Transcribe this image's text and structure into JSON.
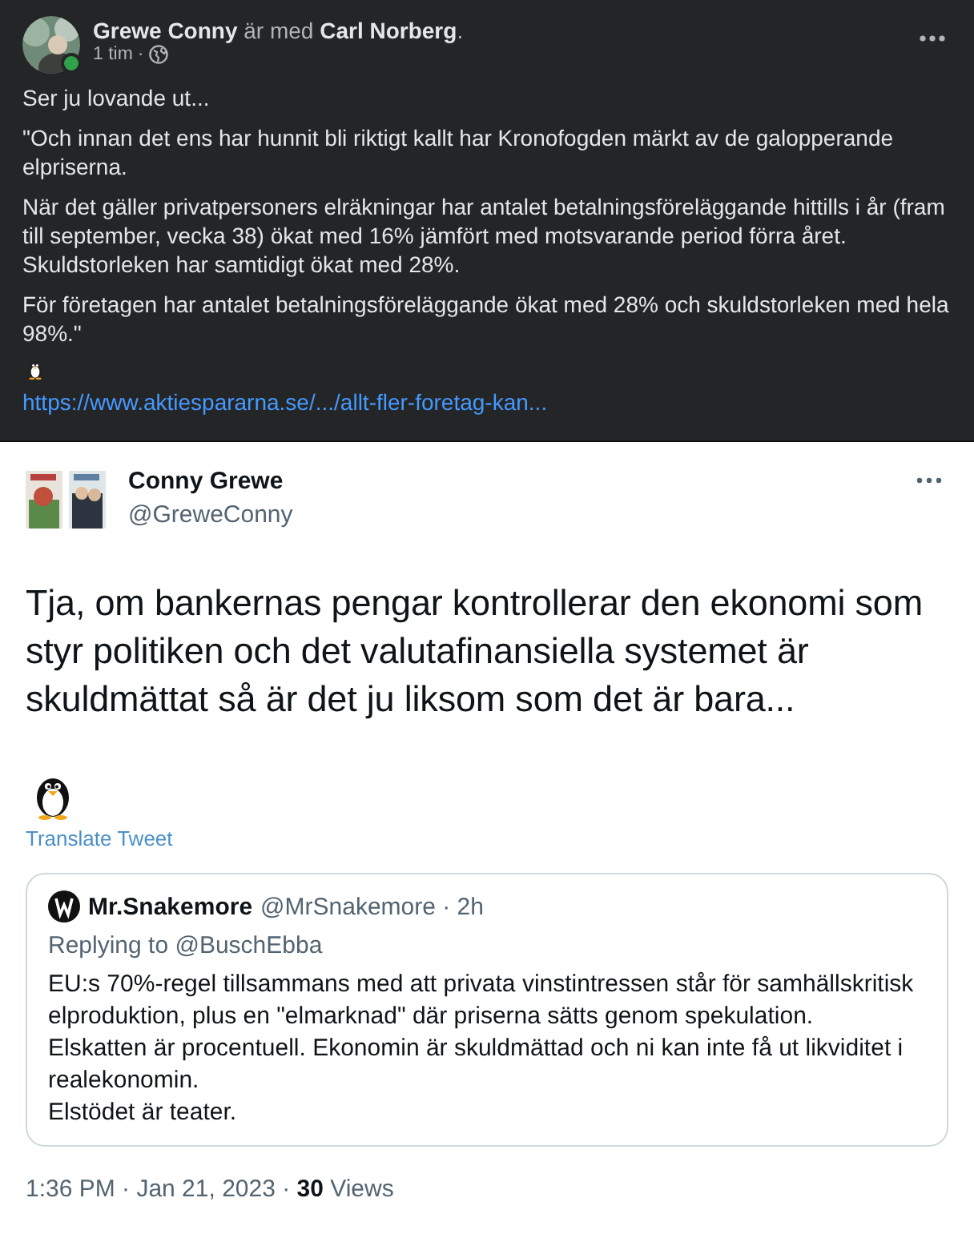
{
  "fb_post": {
    "header": "**Grewe Conny** är med **Carl Norberg**.",
    "time": "1 tim",
    "separator": "·",
    "paragraphs": [
      "Ser ju lovande ut...",
      "\"Och innan det ens har hunnit bli riktigt kallt har Kronofogden märkt av de galopperande elpriserna.",
      "När det gäller privatpersoners elräkningar har antalet betalningsföreläggande hittills i år (fram till september, vecka 38) ökat med 16% jämfört med motsvarande period förra året. Skuldstorleken har samtidigt ökat med 28%.",
      "För företagen har antalet betalningsföreläggande ökat med 28% och skuldstorleken med hela 98%.\""
    ],
    "link": "https://www.aktiespararna.se/.../allt-fler-foretag-kan..."
  },
  "tweet": {
    "name": "Conny Grewe",
    "handle": "@GreweConny",
    "text": "Tja, om bankernas pengar kontrollerar den ekonomi som styr politiken och det valutafinansiella systemet är skuldmättat så är det ju liksom som det är bara...",
    "translate": "Translate Tweet",
    "quote": {
      "name": "Mr.Snakemore",
      "meta": "@MrSnakemore · 2h",
      "replying": "Replying to @BuschEbba",
      "lines": [
        "EU:s 70%-regel tillsammans med att privata vinstintressen står för samhällskritisk elproduktion, plus en \"elmarknad\" där priserna sätts genom spekulation.",
        "Elskatten är procentuell. Ekonomin är skuldmättad och ni kan inte få ut likviditet i realekonomin.",
        "Elstödet är teater."
      ]
    },
    "footer": "1:36 PM · Jan 21, 2023 · **30** Views"
  }
}
